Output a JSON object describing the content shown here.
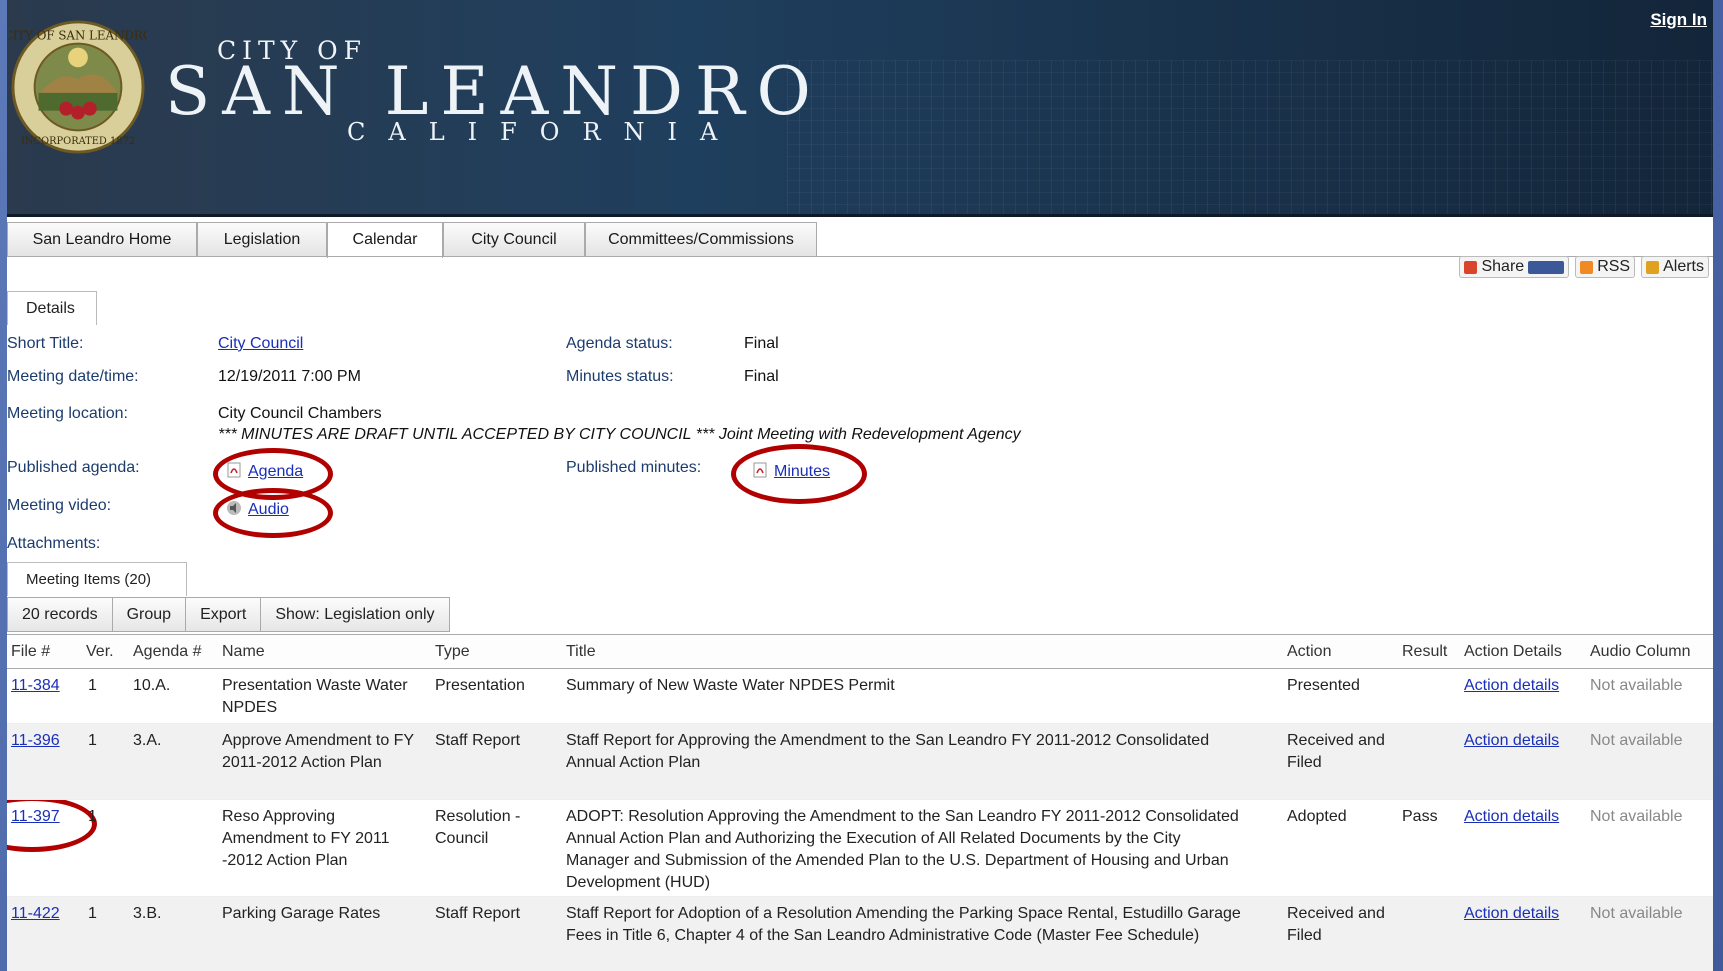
{
  "header": {
    "city_of": "CITY OF",
    "city_name": "SAN LEANDRO",
    "state": "CALIFORNIA",
    "sign_in": "Sign In",
    "seal_text_top": "CITY OF SAN LEANDRO",
    "seal_text_bottom": "INCORPORATED 1872"
  },
  "tabs": [
    {
      "label": "San Leandro Home"
    },
    {
      "label": "Legislation"
    },
    {
      "label": "Calendar"
    },
    {
      "label": "City Council"
    },
    {
      "label": "Committees/Commissions"
    }
  ],
  "share_bar": {
    "share": "Share",
    "rss": "RSS",
    "alerts": "Alerts"
  },
  "details": {
    "tab_label": "Details",
    "short_title_label": "Short Title:",
    "short_title": "City Council",
    "meeting_datetime_label": "Meeting date/time:",
    "meeting_datetime": "12/19/2011 7:00 PM",
    "location_label": "Meeting location:",
    "location": "City Council Chambers",
    "location_note": "*** MINUTES ARE DRAFT UNTIL ACCEPTED BY CITY COUNCIL *** Joint Meeting with Redevelopment Agency",
    "published_agenda_label": "Published agenda:",
    "published_agenda": "Agenda",
    "meeting_video_label": "Meeting video:",
    "meeting_video": "Audio",
    "attachments_label": "Attachments:",
    "agenda_status_label": "Agenda status:",
    "agenda_status": "Final",
    "minutes_status_label": "Minutes status:",
    "minutes_status": "Final",
    "published_minutes_label": "Published minutes:",
    "published_minutes": "Minutes"
  },
  "items": {
    "tab_label": "Meeting Items (20)",
    "toolbar": [
      "20 records",
      "Group",
      "Export",
      "Show: Legislation only"
    ],
    "columns": [
      "File #",
      "Ver.",
      "Agenda #",
      "Name",
      "Type",
      "Title",
      "Action",
      "Result",
      "Action Details",
      "Audio Column"
    ],
    "rows": [
      {
        "file": "11-384",
        "ver": "1",
        "agenda": "10.A.",
        "name": "Presentation Waste Water NPDES",
        "type": "Presentation",
        "title": "Summary of New Waste Water NPDES Permit",
        "action": "Presented",
        "result": "",
        "details": "Action details",
        "audio": "Not available"
      },
      {
        "file": "11-396",
        "ver": "1",
        "agenda": "3.A.",
        "name": "Approve Amendment to FY 2011-2012 Action Plan",
        "type": "Staff Report",
        "title": "Staff Report for Approving the Amendment to the San Leandro FY 2011-2012 Consolidated Annual Action Plan",
        "action": "Received and Filed",
        "result": "",
        "details": "Action details",
        "audio": "Not available"
      },
      {
        "file": "11-397",
        "ver": "1",
        "agenda": "",
        "name": "Reso Approving Amendment to FY 2011 -2012 Action Plan",
        "type": "Resolution - Council",
        "title": "ADOPT: Resolution Approving the Amendment to the San Leandro FY 2011-2012 Consolidated Annual Action Plan and Authorizing the Execution of All Related Documents by the City Manager and Submission of the Amended Plan to the U.S. Department of Housing and Urban Development (HUD)",
        "action": "Adopted",
        "result": "Pass",
        "details": "Action details",
        "audio": "Not available"
      },
      {
        "file": "11-422",
        "ver": "1",
        "agenda": "3.B.",
        "name": "Parking Garage Rates",
        "type": "Staff Report",
        "title": "Staff Report for Adoption of a Resolution Amending the Parking Space Rental, Estudillo Garage Fees in Title 6, Chapter 4 of the San Leandro Administrative Code (Master Fee Schedule)",
        "action": "Received and Filed",
        "result": "",
        "details": "Action details",
        "audio": "Not available"
      }
    ]
  },
  "colors": {
    "link": "#1a2fb8",
    "label": "#1c3c6e",
    "highlight_circle": "#b00000",
    "banner": "#1f3f5e"
  }
}
